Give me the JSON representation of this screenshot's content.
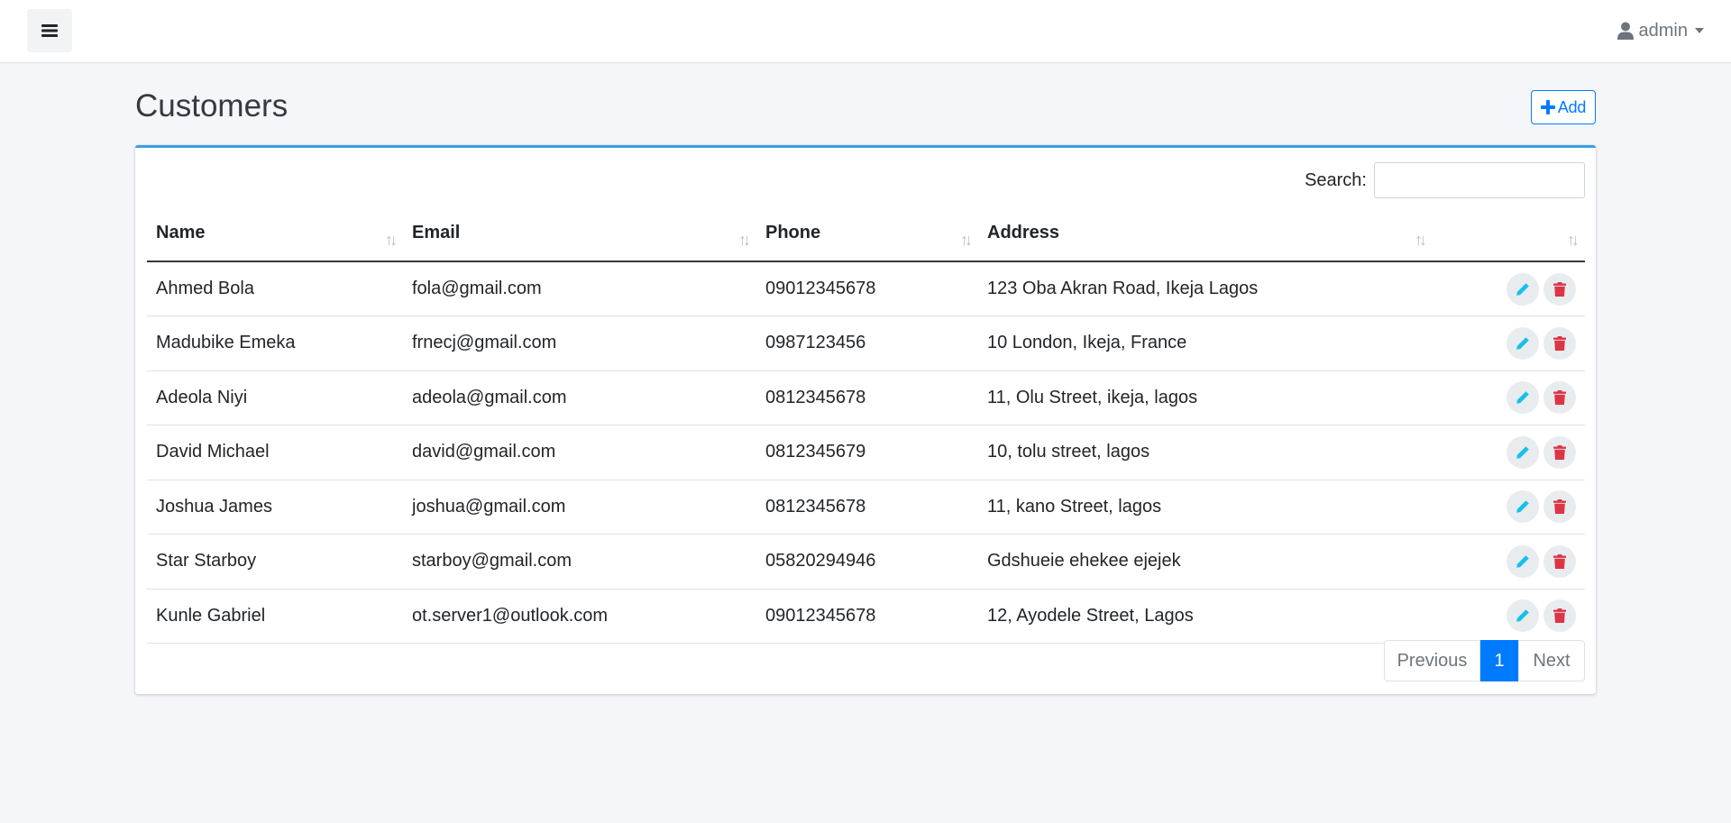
{
  "topbar": {
    "menu_icon": "bars-icon",
    "user": {
      "icon": "user-icon",
      "name": "admin"
    }
  },
  "page": {
    "title": "Customers",
    "add_label": "Add"
  },
  "search": {
    "label": "Search:",
    "value": "",
    "placeholder": ""
  },
  "table": {
    "headers": {
      "name": "Name",
      "email": "Email",
      "phone": "Phone",
      "address": "Address",
      "actions": ""
    },
    "rows": [
      {
        "name": "Ahmed Bola",
        "email": "fola@gmail.com",
        "phone": "09012345678",
        "address": "123 Oba Akran Road, Ikeja Lagos"
      },
      {
        "name": "Madubike Emeka",
        "email": "frnecj@gmail.com",
        "phone": "0987123456",
        "address": "10 London, Ikeja, France"
      },
      {
        "name": "Adeola Niyi",
        "email": "adeola@gmail.com",
        "phone": "0812345678",
        "address": "11, Olu Street, ikeja, lagos"
      },
      {
        "name": "David Michael",
        "email": "david@gmail.com",
        "phone": "0812345679",
        "address": "10, tolu street, lagos"
      },
      {
        "name": "Joshua James",
        "email": "joshua@gmail.com",
        "phone": "0812345678",
        "address": "11, kano Street, lagos"
      },
      {
        "name": "Star Starboy",
        "email": "starboy@gmail.com",
        "phone": "05820294946",
        "address": "Gdshueie ehekee ejejek"
      },
      {
        "name": "Kunle Gabriel",
        "email": "ot.server1@outlook.com",
        "phone": "09012345678",
        "address": "12, Ayodele Street, Lagos"
      }
    ]
  },
  "pagination": {
    "previous": "Previous",
    "current": "1",
    "next": "Next"
  },
  "colors": {
    "primary": "#007bff",
    "card_accent": "#3c9ee5",
    "edit_icon": "#17c1e8",
    "delete_icon": "#dc3545"
  }
}
